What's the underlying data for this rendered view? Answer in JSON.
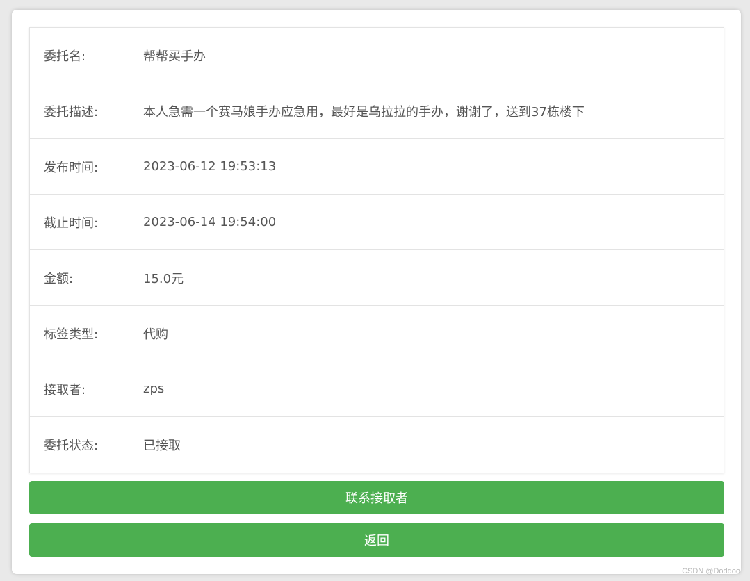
{
  "details": {
    "rows": [
      {
        "label": "委托名:",
        "value": "帮帮买手办"
      },
      {
        "label": "委托描述:",
        "value": "本人急需一个赛马娘手办应急用，最好是乌拉拉的手办，谢谢了，送到37栋楼下"
      },
      {
        "label": "发布时间:",
        "value": "2023-06-12 19:53:13"
      },
      {
        "label": "截止时间:",
        "value": "2023-06-14 19:54:00"
      },
      {
        "label": "金额:",
        "value": "15.0元"
      },
      {
        "label": "标签类型:",
        "value": "代购"
      },
      {
        "label": "接取者:",
        "value": "zps"
      },
      {
        "label": "委托状态:",
        "value": "已接取"
      }
    ]
  },
  "actions": {
    "contact_label": "联系接取者",
    "back_label": "返回"
  },
  "watermark": "CSDN @Doddoo",
  "colors": {
    "accent": "#4caf50",
    "text": "#555555",
    "border": "#e3e3e3"
  }
}
